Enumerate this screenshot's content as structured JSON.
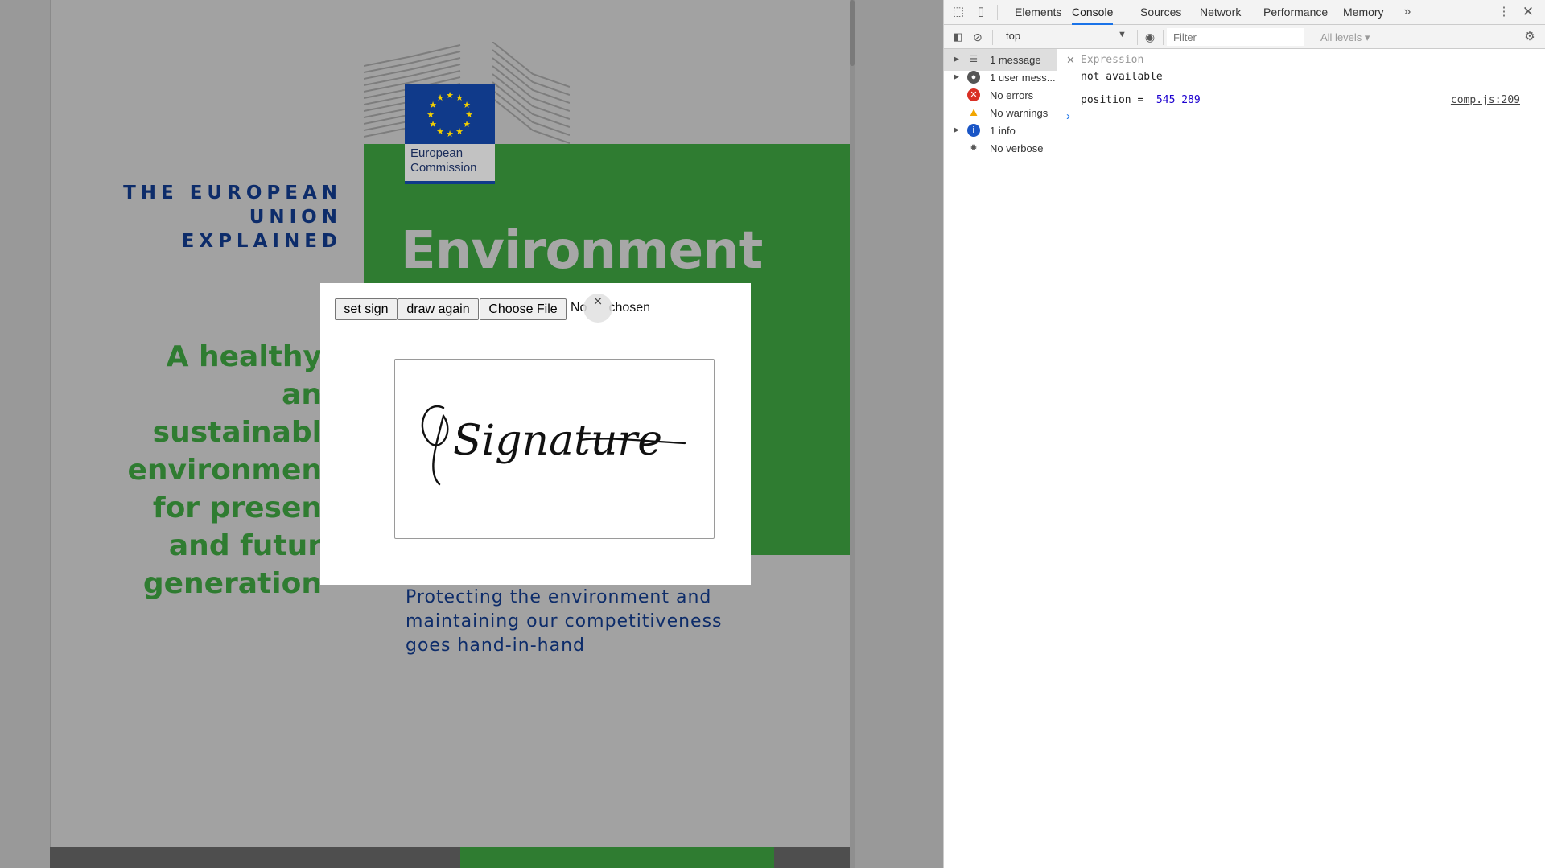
{
  "page": {
    "eu_explained": [
      "THE EUROPEAN",
      "UNION",
      "EXPLAINED"
    ],
    "ec_logo": [
      "European",
      "Commission"
    ],
    "title": "Environment",
    "healthy": [
      "A healthy an",
      "sustainabl",
      "environmen",
      "for presen",
      "and futur",
      "generation"
    ],
    "protecting": [
      "Protecting the environment and",
      "maintaining our competitiveness",
      "goes hand-in-hand"
    ]
  },
  "modal": {
    "set_sign_label": "set sign",
    "draw_again_label": "draw again",
    "choose_file_label": "Choose File",
    "file_status_visible": [
      "No",
      "chosen"
    ],
    "close_icon": "×",
    "signature_text": "Signature"
  },
  "devtools": {
    "tabs": [
      "Elements",
      "Console",
      "Sources",
      "Network",
      "Performance",
      "Memory"
    ],
    "active_tab": "Console",
    "context": "top",
    "filter_placeholder": "Filter",
    "levels": "All levels",
    "sidebar": [
      {
        "label": "1 message",
        "icon": "list-icon"
      },
      {
        "label": "1 user mess...",
        "icon": "user-icon"
      },
      {
        "label": "No errors",
        "icon": "error-icon"
      },
      {
        "label": "No warnings",
        "icon": "warning-icon"
      },
      {
        "label": "1 info",
        "icon": "info-icon"
      },
      {
        "label": "No verbose",
        "icon": "bug-icon"
      }
    ],
    "expression_label": "Expression",
    "expression_value": "not available",
    "log_prefix": "position = ",
    "log_values": "545 289",
    "log_source": "comp.js:209"
  },
  "colors": {
    "eu_green": "#2f7c31",
    "eu_navy": "#0d2c6a",
    "devtools_accent": "#1a73e8"
  }
}
